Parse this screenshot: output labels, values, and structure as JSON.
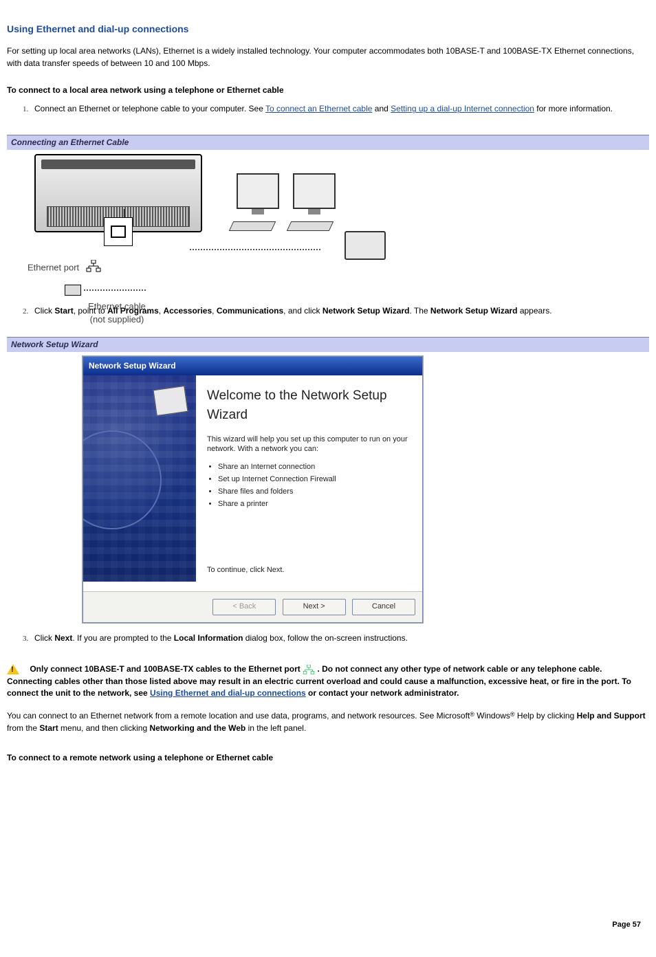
{
  "title": "Using Ethernet and dial-up connections",
  "intro": "For setting up local area networks (LANs), Ethernet is a widely installed technology. Your computer accommodates both 10BASE-T and 100BASE-TX Ethernet connections, with data transfer speeds of between 10 and 100 Mbps.",
  "subhead1": "To connect to a local area network using a telephone or Ethernet cable",
  "step1_pre": "Connect an Ethernet or telephone cable to your computer. See ",
  "step1_link1": "To connect an Ethernet cable",
  "step1_mid": " and ",
  "step1_link2": "Setting up a dial-up Internet connection",
  "step1_post": " for more information.",
  "figure1_caption": "Connecting an Ethernet Cable",
  "fig1_port_label": "Ethernet port",
  "fig1_cable_label1": "Ethernet cable",
  "fig1_cable_label2": "(not supplied)",
  "step2": {
    "pre": "Click ",
    "b1": "Start",
    "s1": ", point to ",
    "b2": "All Programs",
    "s2": ", ",
    "b3": "Accessories",
    "s3": ", ",
    "b4": "Communications",
    "s4": ", and click ",
    "b5": "Network Setup Wizard",
    "s5": ". The ",
    "b6": "Network Setup Wizard",
    "s6": " appears."
  },
  "figure2_caption": "Network Setup Wizard",
  "wizard": {
    "title": "Network Setup Wizard",
    "heading": "Welcome to the Network Setup Wizard",
    "intro": "This wizard will help you set up this computer to run on your network. With a network you can:",
    "bullets": [
      "Share an Internet connection",
      "Set up Internet Connection Firewall",
      "Share files and folders",
      "Share a printer"
    ],
    "continue": "To continue, click Next.",
    "btn_back": "< Back",
    "btn_next": "Next >",
    "btn_cancel": "Cancel"
  },
  "step3": {
    "pre": "Click ",
    "b1": "Next",
    "mid": ". If you are prompted to the ",
    "b2": "Local Information",
    "post": " dialog box, follow the on-screen instructions."
  },
  "warning": {
    "pre": "Only connect 10BASE-T and 100BASE-TX cables to the Ethernet port ",
    "mid": ". Do not connect any other type of network cable or any telephone cable. Connecting cables other than those listed above may result in an electric current overload and could cause a malfunction, excessive heat, or fire in the port. To connect the unit to the network, see ",
    "link": "Using Ethernet and dial-up connections",
    "post": " or contact your network administrator."
  },
  "remote_p": {
    "pre": "You can connect to an Ethernet network from a remote location and use data, programs, and network resources. See Microsoft",
    "reg1": "®",
    "mid1": " Windows",
    "reg2": "®",
    "mid2": " Help by clicking ",
    "b1": "Help and Support",
    "mid3": " from the ",
    "b2": "Start",
    "mid4": " menu, and then clicking ",
    "b3": "Networking and the Web",
    "post": " in the left panel."
  },
  "subhead2": "To connect to a remote network using a telephone or Ethernet cable",
  "page_label": "Page 57"
}
